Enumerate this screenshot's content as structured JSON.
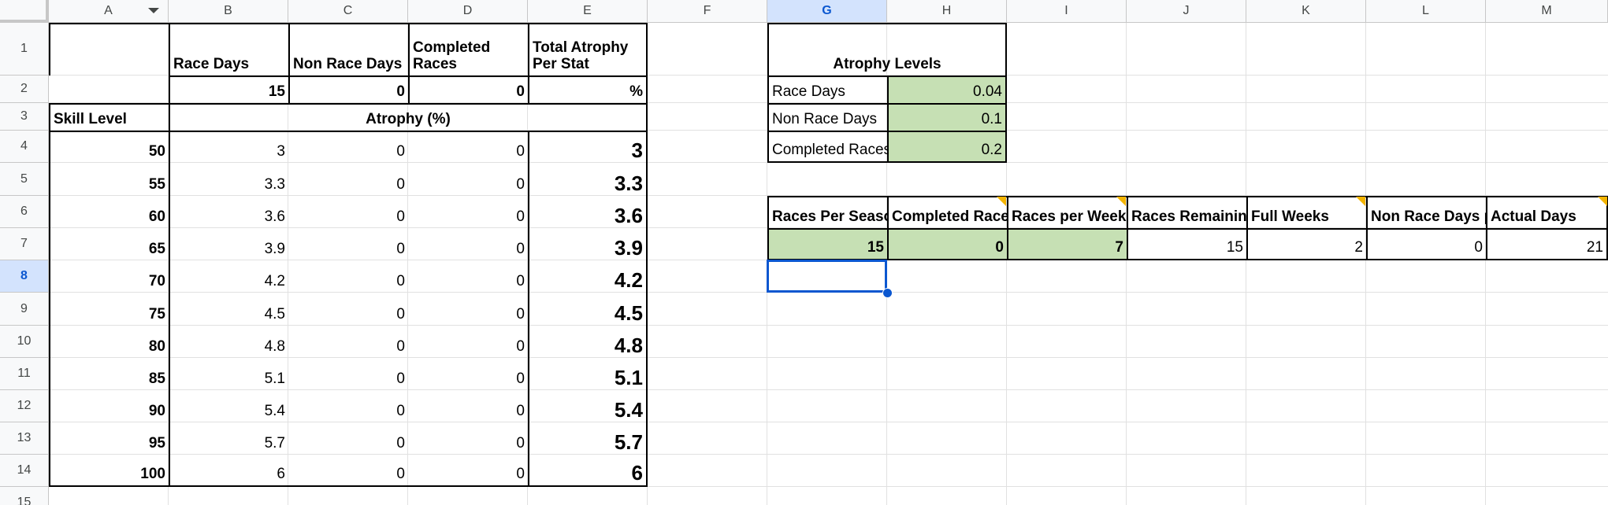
{
  "columns": [
    "A",
    "B",
    "C",
    "D",
    "E",
    "F",
    "G",
    "H",
    "I",
    "J",
    "K",
    "L",
    "M"
  ],
  "rows": [
    "1",
    "2",
    "3",
    "4",
    "5",
    "6",
    "7",
    "8",
    "9",
    "10",
    "11",
    "12",
    "13",
    "14",
    "15"
  ],
  "selected_cell": {
    "column": "G",
    "row": "8"
  },
  "main_table": {
    "headers": {
      "b1": "Race Days",
      "c1": "Non Race Days",
      "d1": "Completed Races",
      "e1": "Total Atrophy Per Stat"
    },
    "row2": {
      "b2": "15",
      "c2": "0",
      "d2": "0",
      "e2": "%"
    },
    "skill_level_label": "Skill Level",
    "atrophy_label": "Atrophy (%)",
    "rows": [
      {
        "skill": "50",
        "race": "3",
        "nonrace": "0",
        "completed": "0",
        "total": "3"
      },
      {
        "skill": "55",
        "race": "3.3",
        "nonrace": "0",
        "completed": "0",
        "total": "3.3"
      },
      {
        "skill": "60",
        "race": "3.6",
        "nonrace": "0",
        "completed": "0",
        "total": "3.6"
      },
      {
        "skill": "65",
        "race": "3.9",
        "nonrace": "0",
        "completed": "0",
        "total": "3.9"
      },
      {
        "skill": "70",
        "race": "4.2",
        "nonrace": "0",
        "completed": "0",
        "total": "4.2"
      },
      {
        "skill": "75",
        "race": "4.5",
        "nonrace": "0",
        "completed": "0",
        "total": "4.5"
      },
      {
        "skill": "80",
        "race": "4.8",
        "nonrace": "0",
        "completed": "0",
        "total": "4.8"
      },
      {
        "skill": "85",
        "race": "5.1",
        "nonrace": "0",
        "completed": "0",
        "total": "5.1"
      },
      {
        "skill": "90",
        "race": "5.4",
        "nonrace": "0",
        "completed": "0",
        "total": "5.4"
      },
      {
        "skill": "95",
        "race": "5.7",
        "nonrace": "0",
        "completed": "0",
        "total": "5.7"
      },
      {
        "skill": "100",
        "race": "6",
        "nonrace": "0",
        "completed": "0",
        "total": "6"
      }
    ]
  },
  "atrophy_levels": {
    "title": "Atrophy Levels",
    "items": [
      {
        "label": "Race Days",
        "value": "0.04"
      },
      {
        "label": "Non Race Days",
        "value": "0.1"
      },
      {
        "label": "Completed Races",
        "value": "0.2"
      }
    ]
  },
  "season_table": {
    "headers": [
      "Races Per Season",
      "Completed Races",
      "Races per Week",
      "Races Remaining",
      "Full Weeks",
      "Non Race Days per Week",
      "Actual Days"
    ],
    "values": [
      "15",
      "0",
      "7",
      "15",
      "2",
      "0",
      "21"
    ]
  },
  "colors": {
    "input_green": "#c6e0b4",
    "selection_blue": "#0b57d0",
    "note_flag": "#f4b400"
  }
}
